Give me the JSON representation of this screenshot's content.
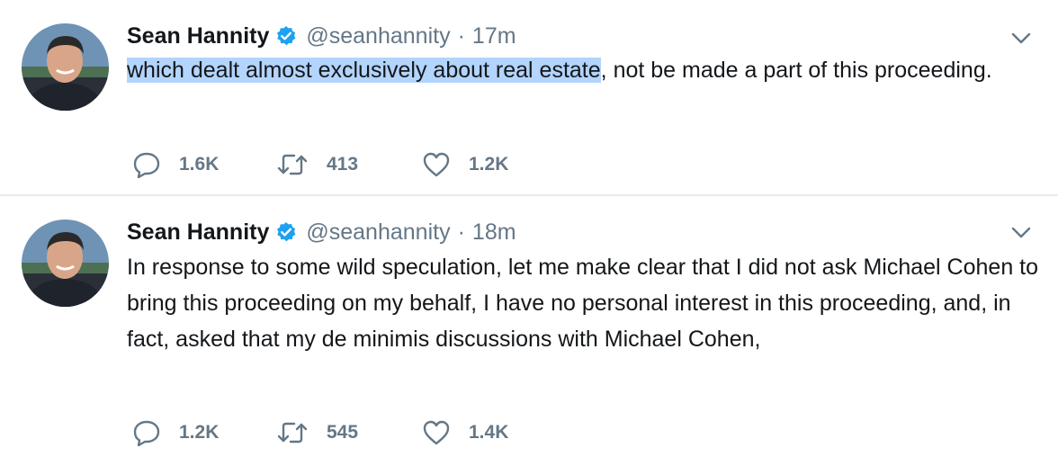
{
  "colors": {
    "accent": "#1da1f2",
    "secondary_text": "#657786",
    "highlight": "#b3d4fc",
    "divider": "#e6ecf0"
  },
  "tweets": [
    {
      "name": "Sean Hannity",
      "verified": true,
      "handle": "@seanhannity",
      "separator": "·",
      "time": "17m",
      "text_highlighted": "which dealt almost exclusively about real estate",
      "text_rest": ", not be made a part of this proceeding.",
      "replies": "1.6K",
      "retweets": "413",
      "likes": "1.2K"
    },
    {
      "name": "Sean Hannity",
      "verified": true,
      "handle": "@seanhannity",
      "separator": "·",
      "time": "18m",
      "text": "In response to some wild speculation, let me make clear that I did not ask Michael Cohen to bring this proceeding on my behalf, I have no personal interest in this proceeding, and, in fact, asked that my de minimis discussions with Michael Cohen,",
      "replies": "1.2K",
      "retweets": "545",
      "likes": "1.4K"
    }
  ],
  "icons": {
    "avatar": "profile-photo",
    "verified": "verified-badge-icon",
    "caret": "chevron-down-icon",
    "reply": "reply-icon",
    "retweet": "retweet-icon",
    "like": "heart-icon"
  }
}
